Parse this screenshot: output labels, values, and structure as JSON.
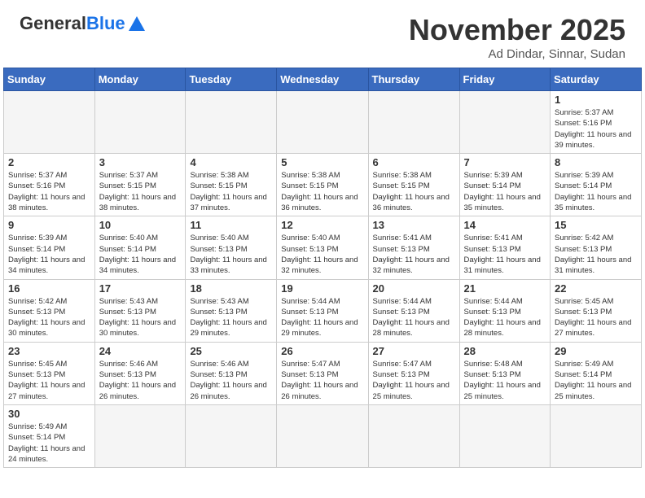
{
  "header": {
    "logo_general": "General",
    "logo_blue": "Blue",
    "month_title": "November 2025",
    "location": "Ad Dindar, Sinnar, Sudan"
  },
  "weekdays": [
    "Sunday",
    "Monday",
    "Tuesday",
    "Wednesday",
    "Thursday",
    "Friday",
    "Saturday"
  ],
  "weeks": [
    [
      {
        "day": null,
        "sunrise": null,
        "sunset": null,
        "daylight": null
      },
      {
        "day": null,
        "sunrise": null,
        "sunset": null,
        "daylight": null
      },
      {
        "day": null,
        "sunrise": null,
        "sunset": null,
        "daylight": null
      },
      {
        "day": null,
        "sunrise": null,
        "sunset": null,
        "daylight": null
      },
      {
        "day": null,
        "sunrise": null,
        "sunset": null,
        "daylight": null
      },
      {
        "day": null,
        "sunrise": null,
        "sunset": null,
        "daylight": null
      },
      {
        "day": "1",
        "sunrise": "5:37 AM",
        "sunset": "5:16 PM",
        "daylight": "11 hours and 39 minutes."
      }
    ],
    [
      {
        "day": "2",
        "sunrise": "5:37 AM",
        "sunset": "5:16 PM",
        "daylight": "11 hours and 38 minutes."
      },
      {
        "day": "3",
        "sunrise": "5:37 AM",
        "sunset": "5:15 PM",
        "daylight": "11 hours and 38 minutes."
      },
      {
        "day": "4",
        "sunrise": "5:38 AM",
        "sunset": "5:15 PM",
        "daylight": "11 hours and 37 minutes."
      },
      {
        "day": "5",
        "sunrise": "5:38 AM",
        "sunset": "5:15 PM",
        "daylight": "11 hours and 36 minutes."
      },
      {
        "day": "6",
        "sunrise": "5:38 AM",
        "sunset": "5:15 PM",
        "daylight": "11 hours and 36 minutes."
      },
      {
        "day": "7",
        "sunrise": "5:39 AM",
        "sunset": "5:14 PM",
        "daylight": "11 hours and 35 minutes."
      },
      {
        "day": "8",
        "sunrise": "5:39 AM",
        "sunset": "5:14 PM",
        "daylight": "11 hours and 35 minutes."
      }
    ],
    [
      {
        "day": "9",
        "sunrise": "5:39 AM",
        "sunset": "5:14 PM",
        "daylight": "11 hours and 34 minutes."
      },
      {
        "day": "10",
        "sunrise": "5:40 AM",
        "sunset": "5:14 PM",
        "daylight": "11 hours and 34 minutes."
      },
      {
        "day": "11",
        "sunrise": "5:40 AM",
        "sunset": "5:13 PM",
        "daylight": "11 hours and 33 minutes."
      },
      {
        "day": "12",
        "sunrise": "5:40 AM",
        "sunset": "5:13 PM",
        "daylight": "11 hours and 32 minutes."
      },
      {
        "day": "13",
        "sunrise": "5:41 AM",
        "sunset": "5:13 PM",
        "daylight": "11 hours and 32 minutes."
      },
      {
        "day": "14",
        "sunrise": "5:41 AM",
        "sunset": "5:13 PM",
        "daylight": "11 hours and 31 minutes."
      },
      {
        "day": "15",
        "sunrise": "5:42 AM",
        "sunset": "5:13 PM",
        "daylight": "11 hours and 31 minutes."
      }
    ],
    [
      {
        "day": "16",
        "sunrise": "5:42 AM",
        "sunset": "5:13 PM",
        "daylight": "11 hours and 30 minutes."
      },
      {
        "day": "17",
        "sunrise": "5:43 AM",
        "sunset": "5:13 PM",
        "daylight": "11 hours and 30 minutes."
      },
      {
        "day": "18",
        "sunrise": "5:43 AM",
        "sunset": "5:13 PM",
        "daylight": "11 hours and 29 minutes."
      },
      {
        "day": "19",
        "sunrise": "5:44 AM",
        "sunset": "5:13 PM",
        "daylight": "11 hours and 29 minutes."
      },
      {
        "day": "20",
        "sunrise": "5:44 AM",
        "sunset": "5:13 PM",
        "daylight": "11 hours and 28 minutes."
      },
      {
        "day": "21",
        "sunrise": "5:44 AM",
        "sunset": "5:13 PM",
        "daylight": "11 hours and 28 minutes."
      },
      {
        "day": "22",
        "sunrise": "5:45 AM",
        "sunset": "5:13 PM",
        "daylight": "11 hours and 27 minutes."
      }
    ],
    [
      {
        "day": "23",
        "sunrise": "5:45 AM",
        "sunset": "5:13 PM",
        "daylight": "11 hours and 27 minutes."
      },
      {
        "day": "24",
        "sunrise": "5:46 AM",
        "sunset": "5:13 PM",
        "daylight": "11 hours and 26 minutes."
      },
      {
        "day": "25",
        "sunrise": "5:46 AM",
        "sunset": "5:13 PM",
        "daylight": "11 hours and 26 minutes."
      },
      {
        "day": "26",
        "sunrise": "5:47 AM",
        "sunset": "5:13 PM",
        "daylight": "11 hours and 26 minutes."
      },
      {
        "day": "27",
        "sunrise": "5:47 AM",
        "sunset": "5:13 PM",
        "daylight": "11 hours and 25 minutes."
      },
      {
        "day": "28",
        "sunrise": "5:48 AM",
        "sunset": "5:13 PM",
        "daylight": "11 hours and 25 minutes."
      },
      {
        "day": "29",
        "sunrise": "5:49 AM",
        "sunset": "5:14 PM",
        "daylight": "11 hours and 25 minutes."
      }
    ],
    [
      {
        "day": "30",
        "sunrise": "5:49 AM",
        "sunset": "5:14 PM",
        "daylight": "11 hours and 24 minutes."
      },
      {
        "day": null,
        "sunrise": null,
        "sunset": null,
        "daylight": null
      },
      {
        "day": null,
        "sunrise": null,
        "sunset": null,
        "daylight": null
      },
      {
        "day": null,
        "sunrise": null,
        "sunset": null,
        "daylight": null
      },
      {
        "day": null,
        "sunrise": null,
        "sunset": null,
        "daylight": null
      },
      {
        "day": null,
        "sunrise": null,
        "sunset": null,
        "daylight": null
      },
      {
        "day": null,
        "sunrise": null,
        "sunset": null,
        "daylight": null
      }
    ]
  ],
  "labels": {
    "sunrise": "Sunrise:",
    "sunset": "Sunset:",
    "daylight": "Daylight:"
  }
}
